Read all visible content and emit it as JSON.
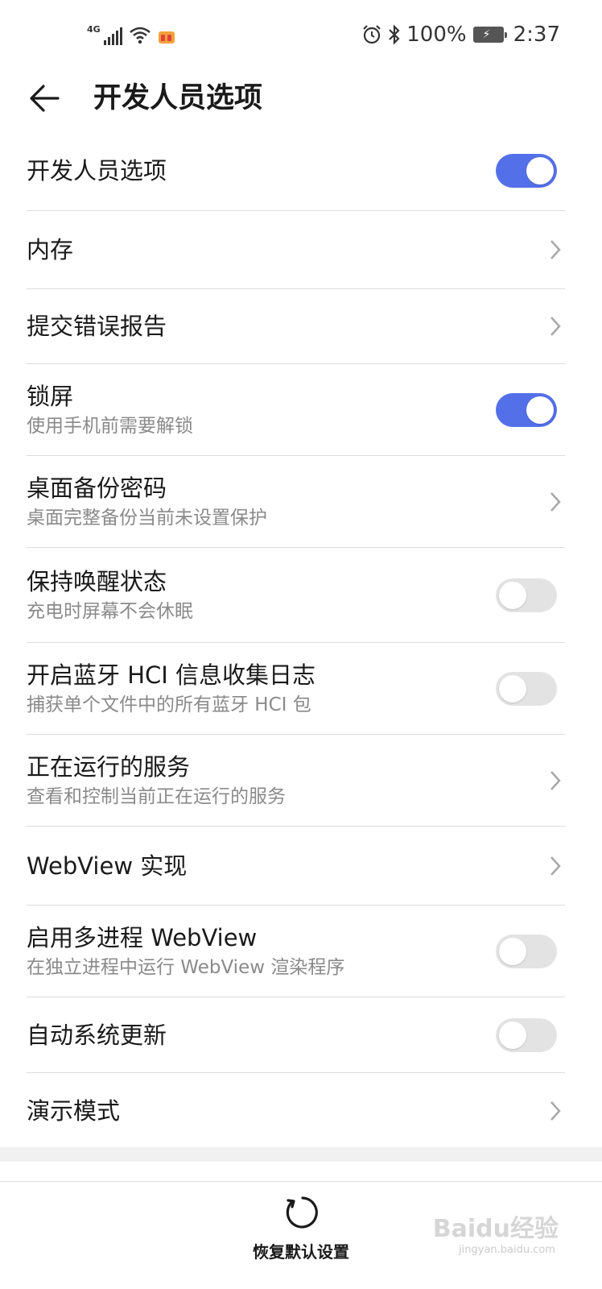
{
  "status_bar": {
    "network": "4G",
    "battery_percent": "100%",
    "time": "2:37"
  },
  "header": {
    "title": "开发人员选项"
  },
  "items": [
    {
      "title": "开发人员选项",
      "subtitle": "",
      "control": "toggle",
      "on": true
    },
    {
      "title": "内存",
      "subtitle": "",
      "control": "chevron"
    },
    {
      "title": "提交错误报告",
      "subtitle": "",
      "control": "chevron"
    },
    {
      "title": "锁屏",
      "subtitle": "使用手机前需要解锁",
      "control": "toggle",
      "on": true
    },
    {
      "title": "桌面备份密码",
      "subtitle": "桌面完整备份当前未设置保护",
      "control": "chevron"
    },
    {
      "title": "保持唤醒状态",
      "subtitle": "充电时屏幕不会休眠",
      "control": "toggle",
      "on": false
    },
    {
      "title": "开启蓝牙 HCI 信息收集日志",
      "subtitle": "捕获单个文件中的所有蓝牙 HCI 包",
      "control": "toggle",
      "on": false
    },
    {
      "title": "正在运行的服务",
      "subtitle": "查看和控制当前正在运行的服务",
      "control": "chevron"
    },
    {
      "title": "WebView 实现",
      "subtitle": "",
      "control": "chevron"
    },
    {
      "title": "启用多进程 WebView",
      "subtitle": "在独立进程中运行 WebView 渲染程序",
      "control": "toggle",
      "on": false
    },
    {
      "title": "自动系统更新",
      "subtitle": "",
      "control": "toggle",
      "on": false
    },
    {
      "title": "演示模式",
      "subtitle": "",
      "control": "chevron"
    }
  ],
  "bottom": {
    "reset_label": "恢复默认设置"
  },
  "watermark": {
    "text": "Baidu经验",
    "sub": "jingyan.baidu.com"
  },
  "colors": {
    "accent": "#5470e8",
    "toggle_off": "#e3e3e3",
    "divider": "#dcdcdc",
    "subtitle": "#8a8a8a"
  }
}
